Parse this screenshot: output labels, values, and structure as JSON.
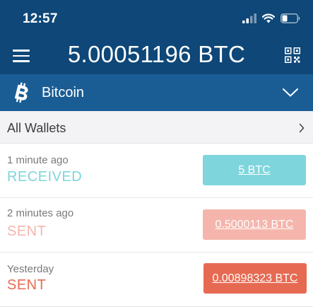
{
  "status_bar": {
    "time": "12:57",
    "icons": [
      "signal-icon",
      "wifi-icon",
      "battery-icon"
    ]
  },
  "header": {
    "balance": "5.00051196 BTC",
    "menu_icon": "hamburger-menu-icon",
    "qr_icon": "qr-code-icon"
  },
  "coin_selector": {
    "name": "Bitcoin",
    "icon": "bitcoin-icon",
    "chevron_icon": "chevron-down-icon"
  },
  "wallet_filter": {
    "label": "All Wallets",
    "chevron_icon": "chevron-right-icon"
  },
  "transactions": [
    {
      "time": "1 minute ago",
      "type": "RECEIVED",
      "amount": "5 BTC",
      "type_color": "#7fd5dc",
      "button_color": "#7fd5dc"
    },
    {
      "time": "2 minutes ago",
      "type": "SENT",
      "amount": "0.5000113 BTC",
      "type_color": "#f5b5ac",
      "button_color": "#f5b5ac"
    },
    {
      "time": "Yesterday",
      "type": "SENT",
      "amount": "0.00898323 BTC",
      "type_color": "#e66a52",
      "button_color": "#e66a52"
    }
  ],
  "colors": {
    "header_bg": "#0e4778",
    "coin_bar_bg": "#1a5d94",
    "filter_bg": "#f3f3f5"
  }
}
